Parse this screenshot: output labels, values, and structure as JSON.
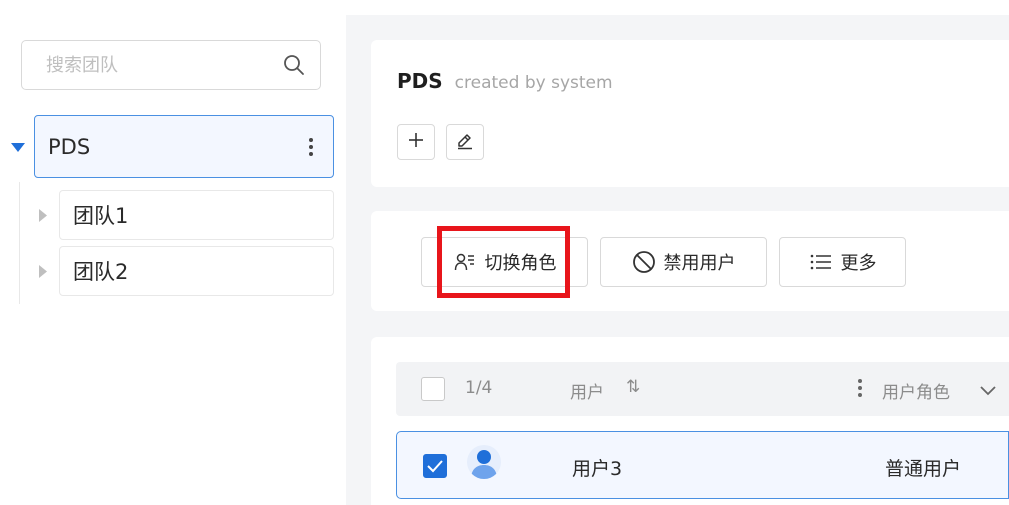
{
  "sidebar": {
    "search": {
      "placeholder": "搜索团队",
      "icon": "search-icon"
    },
    "root_node": {
      "label": "PDS",
      "expanded": true
    },
    "children": [
      {
        "label": "团队1"
      },
      {
        "label": "团队2"
      }
    ]
  },
  "team_header": {
    "name": "PDS",
    "meta": "created by system",
    "add_icon": "plus-icon",
    "edit_icon": "edit-icon"
  },
  "actions": {
    "switch_role": "切换角色",
    "disable_user": "禁用用户",
    "more": "更多"
  },
  "table": {
    "selection_count": "1/4",
    "col_user": "用户",
    "sort_glyph": "⇅",
    "col_role": "用户角色",
    "rows": [
      {
        "name": "用户3",
        "role": "普通用户",
        "checked": true
      }
    ]
  },
  "colors": {
    "primary": "#1f6fd9",
    "selected_bg": "#f3f7ff",
    "highlight": "#e8151b",
    "panel_bg": "#f4f5f7"
  }
}
